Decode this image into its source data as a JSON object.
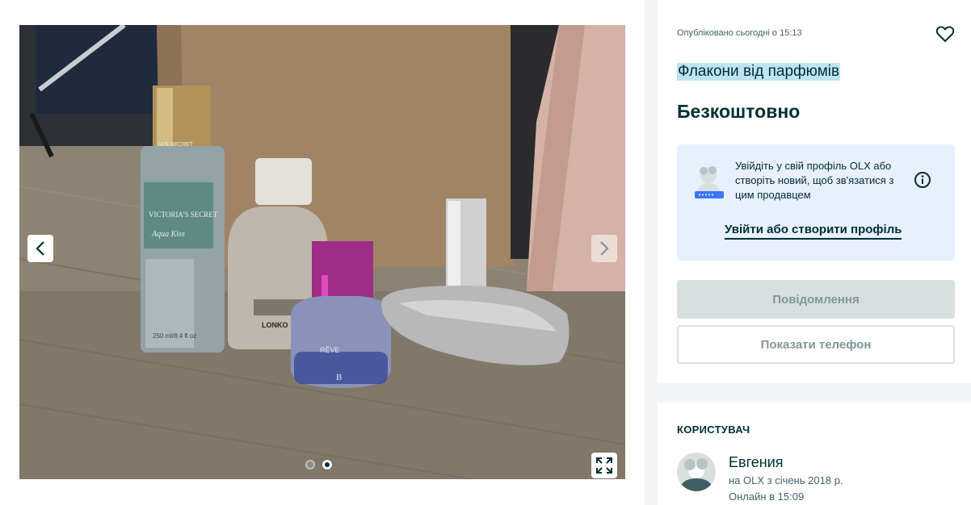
{
  "gallery": {
    "prev_icon": "chevron-left-icon",
    "next_icon": "chevron-right-icon",
    "fullscreen_icon": "expand-icon",
    "slide_count": 2,
    "active_slide": 2,
    "photo_bottle_labels": {
      "bottle1_brand": "VICTORIA'S SECRET",
      "bottle1_name": "Aqua Kiss",
      "bottle1_volume": "250 ml/8.4 fl oz",
      "bottle1_cap": "IA'S SECRET",
      "bottle2_label": "LONKO",
      "bottle3_label": "RÊVE",
      "bottle3_letter": "B"
    }
  },
  "listing": {
    "published": "Опубліковано сьогодні о 15:13",
    "favorite_icon": "heart-icon",
    "title": "Флакони від парфюмів",
    "price": "Безкоштовно"
  },
  "login_prompt": {
    "text": "Увійдіть у свій профіль OLX або створіть новий, щоб зв'язатися з цим продавцем",
    "info_icon": "info-icon",
    "link": "Увійти або створити профіль"
  },
  "actions": {
    "message": "Повідомлення",
    "show_phone": "Показати телефон"
  },
  "user": {
    "heading": "КОРИСТУВАЧ",
    "name": "Евгения",
    "since": "на OLX з січень 2018 р.",
    "online": "Онлайн в 15:09"
  },
  "colors": {
    "brand_dark": "#002f34",
    "login_box_bg": "#e8effd",
    "title_highlight": "#bfe3f0",
    "disabled_button": "#d8dfe0"
  }
}
